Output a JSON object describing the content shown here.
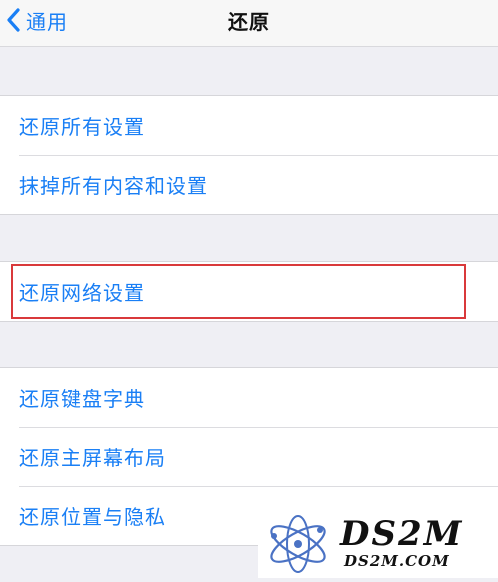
{
  "navbar": {
    "back_label": "通用",
    "title": "还原"
  },
  "groups": [
    {
      "items": [
        {
          "label": "还原所有设置"
        },
        {
          "label": "抹掉所有内容和设置"
        }
      ]
    },
    {
      "items": [
        {
          "label": "还原网络设置",
          "highlighted": true
        }
      ]
    },
    {
      "items": [
        {
          "label": "还原键盘字典"
        },
        {
          "label": "还原主屏幕布局"
        },
        {
          "label": "还原位置与隐私"
        }
      ]
    }
  ],
  "watermark": {
    "brand": "DS2M",
    "domain": "DS2M.COM"
  },
  "colors": {
    "accent": "#1a7ff5",
    "background": "#efeff4",
    "highlight": "#d9393b",
    "watermark_logo": "#4a72c4"
  },
  "icons": {
    "back": "chevron-left-icon",
    "watermark": "atom-logo-icon"
  }
}
